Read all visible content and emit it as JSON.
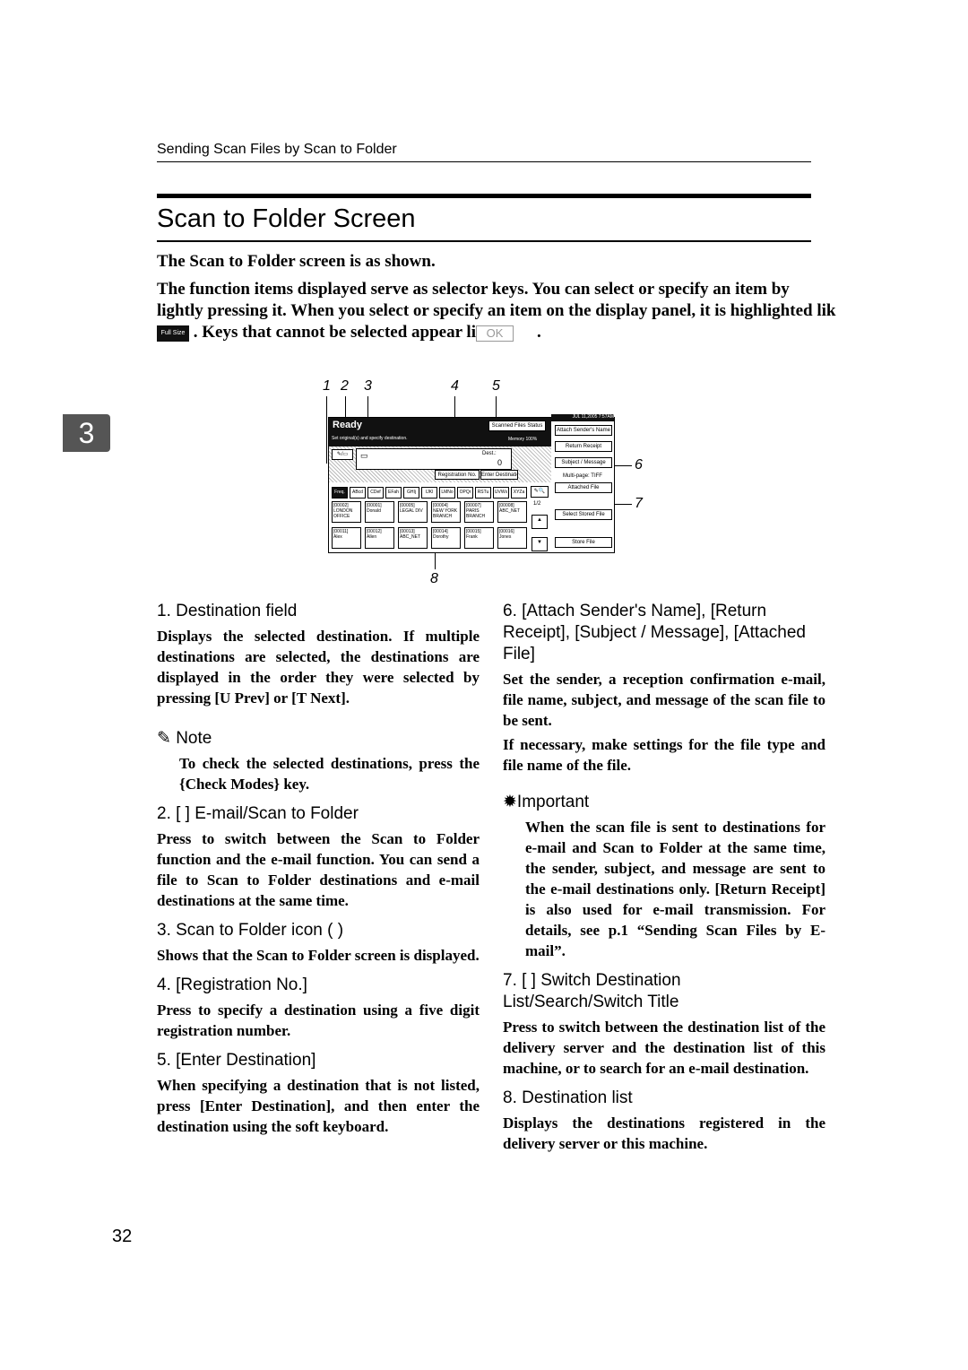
{
  "running_header": "Sending Scan Files by Scan to Folder",
  "title": "Scan to Folder Screen",
  "intro": {
    "p1": "The Scan to Folder screen is as shown.",
    "p2a": "The function items displayed serve as selector keys. You can select or specify an item by lightly pressing it. When you select or specify an item on the display panel, it is highlighted lik",
    "highlight_key": "Full Size",
    "p2b": ". Keys that cannot be selected appear li",
    "disabled_key": "OK",
    "p2c": "."
  },
  "chapter_tab": "3",
  "diagram": {
    "callouts": [
      "1",
      "2",
      "3",
      "4",
      "5",
      "6",
      "7",
      "8"
    ],
    "datetime": "JUL  11,2005  7:57AM",
    "status": "Ready",
    "instruction": "Set original(s) and specify destination.",
    "scanned_files_status": "Scanned Files Status",
    "memory": "Memory 100%",
    "dest_label": "Dest.:",
    "dest_count": "0",
    "registration_no": "Registration No.",
    "enter_destination": "Enter Destination",
    "tabs": [
      "Freq.",
      "ABcd",
      "CDef",
      "EFah",
      "GHIj",
      "IJKl",
      "LMNo",
      "OPQr",
      "RSTu",
      "UVWx",
      "XYZa"
    ],
    "page_indicator": "1/2",
    "destinations": [
      {
        "id": "[00002]",
        "name": "LONDON OFFICE"
      },
      {
        "id": "[00001]",
        "name": "Donald"
      },
      {
        "id": "[00005]",
        "name": "LEGAL DIV"
      },
      {
        "id": "[00004]",
        "name": "NEW YORK BRANCH"
      },
      {
        "id": "[00007]",
        "name": "PARIS BRANCH"
      },
      {
        "id": "[00008]",
        "name": "ABC_NET"
      },
      {
        "id": "[00011]",
        "name": "Alex"
      },
      {
        "id": "[00012]",
        "name": "Allen"
      },
      {
        "id": "[00013]",
        "name": "ABC_NET"
      },
      {
        "id": "[00014]",
        "name": "Dorothy"
      },
      {
        "id": "[00015]",
        "name": "Frank"
      },
      {
        "id": "[00016]",
        "name": "Jones"
      }
    ],
    "right_keys": [
      "Attach Sender's Name",
      "Return Receipt",
      "Subject / Message",
      "Multi-page: TIFF",
      "Attached File",
      "Select Stored File",
      "Store File"
    ]
  },
  "left_items": [
    {
      "heading": "1. Destination field",
      "body": "Displays the selected destination. If multiple destinations are selected, the destinations are displayed in the order they were selected by pressing [U Prev] or [T Next]."
    },
    {
      "note_label": "Note",
      "note_body": "To check the selected destinations, press the {Check Modes} key."
    },
    {
      "heading": "2. [ ] E-mail/Scan to Folder",
      "body": "Press to switch between the Scan to Folder function and the e-mail function. You can send a file to Scan to Folder destinations and e-mail destinations at the same time."
    },
    {
      "heading": "3. Scan to Folder icon ( )",
      "body": "Shows that the Scan to Folder screen is displayed."
    },
    {
      "heading": "4. [Registration No.]",
      "body": "Press to specify a destination using a five digit registration number."
    },
    {
      "heading": "5. [Enter Destination]",
      "body": "When specifying a destination that is not listed, press [Enter Destination], and then enter the destination using the soft keyboard."
    }
  ],
  "right_items": [
    {
      "heading": "6. [Attach Sender's Name], [Return Receipt], [Subject / Message], [Attached File]",
      "body": "Set the sender, a reception confirmation e-mail, file name, subject, and message of the scan file to be sent.",
      "body2": "If necessary, make settings for the file type and file name of the file."
    },
    {
      "important_label": "Important",
      "important_body": "When the scan file is sent to destinations for e-mail and Scan to Folder at the same time, the sender, subject, and message are sent to the e-mail destinations only. [Return Receipt] is also used for e-mail transmission. For details, see p.1 “Sending Scan Files by E-mail”."
    },
    {
      "heading": "7. [ ] Switch Destination List/Search/Switch Title",
      "body": "Press to switch between the destination list of the delivery server and the destination list of this machine, or to search for an e-mail destination."
    },
    {
      "heading": "8. Destination list",
      "body": "Displays the destinations registered in the delivery server or this machine."
    }
  ],
  "page_number": "32"
}
